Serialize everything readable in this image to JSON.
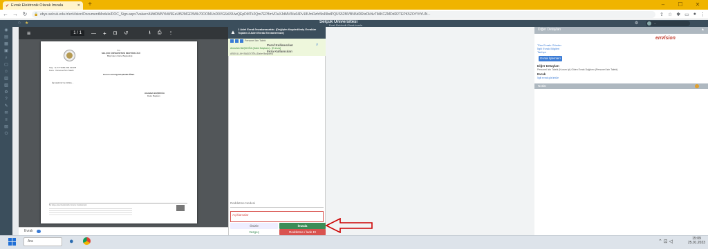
{
  "browser": {
    "tab_title": "Evrak Elektronik Olarak İmzala",
    "new_tab": "+",
    "url": "ebys.selcuk.edu.tr/enVision/DocumentModule/DOC_Sign.aspx?value=AMdDMNYkW9EeUf52MGFBWk70OOMUoD0VG6dJ9UwQEpDMTk2Qm7EP8mVDuXJdMV/Nu64Pv18UmRzfc5b49bdPQUS52MVBN5dDRtzDkNvTiMKCZMDdR2TEPK5ZOYVtYUN...",
    "win_min": "‒",
    "win_max": "☐",
    "win_close": "✕"
  },
  "app": {
    "title": "Selçuk Üniversitesi",
    "subtitle": "Evrak Elektronik Olarak İmzala",
    "user": "..."
  },
  "pdf": {
    "page_indicator": "1 / 1",
    "zoom_minus": "—",
    "zoom_plus": "+"
  },
  "document": {
    "line1": "T.C.",
    "line2": "SELÇUK ÜNİVERSİTESİ REKTÖRLÜĞÜ",
    "line3": "Bilgi İşlem Daire Başkanlığı",
    "sayi": "Sayı : E-7771682-903.02/478",
    "konu": "Konu : Personel İzin Talebi",
    "to": "Kurum Amirliği BAŞKANLIĞINA",
    "body": "İlgi talebiniz ile birlikte...",
    "signer": "Abdullah BAŞDOĞA",
    "signer_title": "Daire Başkanı",
    "footer": "Bu belge güvenli elektronik imza ile imzalanmıştır."
  },
  "middle": {
    "header": "1 Adet Evrak İmzalanacaktır. (Değişim Kaydedilmiş Evraklar Toplam 3 Adet Evrak Envanterinde)",
    "checkbox_label": "Personel İzin Talebi",
    "item_title": "Paraf Kullanıcıları",
    "item_user1": "Abdullah BAŞDOĞA (Daire Başkanı) - [E-imza]",
    "item_sub": "İmza Kullanıcıları",
    "item_user2": "ABDULLAH BAŞDOĞA (Daire Başkanı)",
    "note_label": "Reddetme Nedeni",
    "note_placeholder": "Açıklamalar",
    "btn_preview": "Önizle",
    "btn_sign": "İmzala",
    "btn_cancel": "Vazgeç",
    "btn_reject": "Reddetme / İade Et"
  },
  "pdf_footer": {
    "label": "Evrak"
  },
  "right": {
    "header": "Diğer Detayları",
    "logo": "enVision",
    "links": [
      "Tüm Evrakı Gönder",
      "İlgili Evrak Bilgileri",
      "Tarihçe"
    ],
    "button": "Evrak İşlemleri",
    "section": "Diğer Detayları",
    "detail": "Personel İzin Talebi (Kurum İçi) Giden Evrak Dağıtımı (Personel İzin Talebi)",
    "sub": "Evrak",
    "sub_item": "İlgili evrak görüntüle",
    "bottom_header": "Notlar"
  },
  "taskbar": {
    "search": "Ara",
    "time": "15:09",
    "date": "25.01.2023"
  },
  "colors": {
    "chrome_yellow": "#f0b400",
    "app_dark": "#3b4e5c",
    "sign_green": "#3b8d57",
    "reject_red": "#d9534f",
    "arrow_red": "#cc0000"
  }
}
